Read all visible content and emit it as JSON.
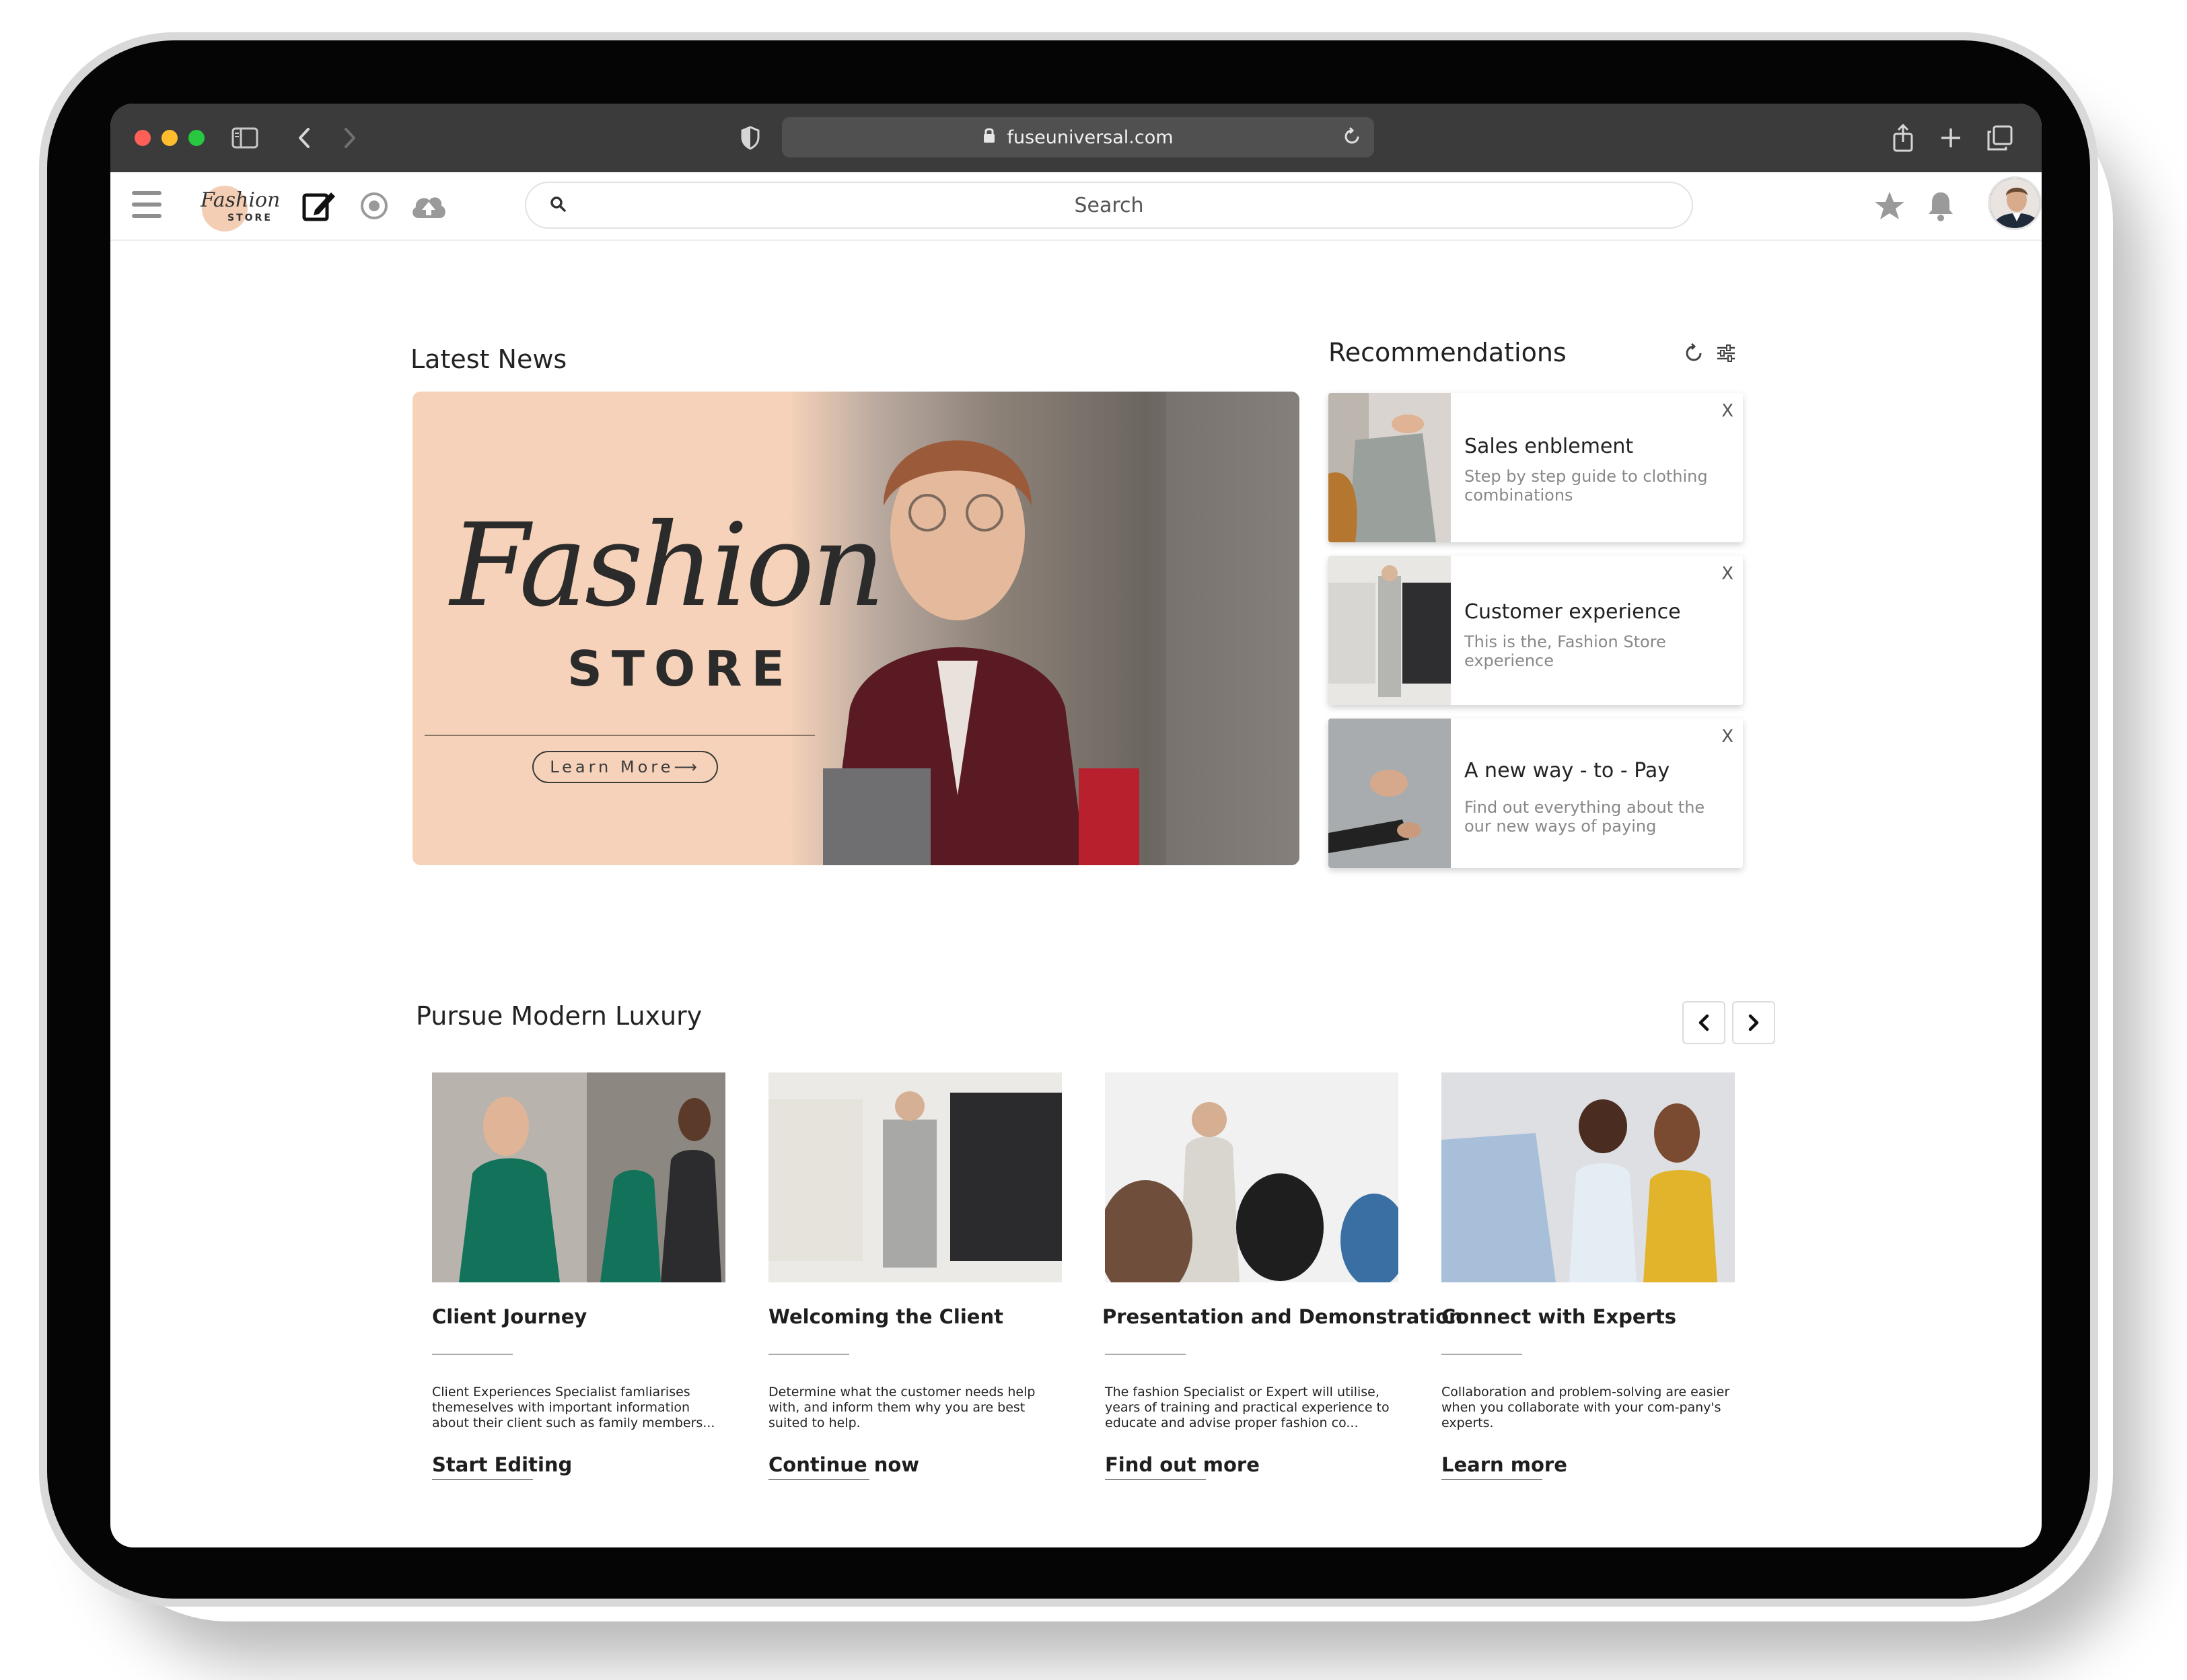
{
  "browser": {
    "url": "fuseuniversal.com"
  },
  "header": {
    "logo_text": "Fashion",
    "logo_subtext": "STORE",
    "search_placeholder": "Search"
  },
  "latest_news": {
    "title": "Latest News",
    "hero": {
      "script_text": "Fashion",
      "store_text": "STORE",
      "button_label": "Learn More⟶"
    }
  },
  "recommendations": {
    "title": "Recommendations",
    "items": [
      {
        "title": "Sales enblement",
        "description": "Step by step guide to clothing combinations",
        "close": "X"
      },
      {
        "title": "Customer experience",
        "description": "This is the, Fashion Store experience",
        "close": "X"
      },
      {
        "title": "A new way - to - Pay",
        "description": "Find out everything about the our new ways of paying",
        "close": "X"
      }
    ]
  },
  "luxury": {
    "title": "Pursue Modern Luxury",
    "cards": [
      {
        "title": "Client Journey",
        "description": "Client Experiences Specialist famliarises themeselves with important information about their client such as family members...",
        "link": "Start Editing"
      },
      {
        "title": "Welcoming the Client",
        "description": "Determine what the customer needs help with, and inform them why you are best suited to help.",
        "link": "Continue now"
      },
      {
        "title": "Presentation and Demonstration",
        "description": "The fashion Specialist or Expert will utilise, years of training and practical experience to educate and advise proper fashion co...",
        "link": "Find out more"
      },
      {
        "title": "Connect with Experts",
        "description": "Collaboration and problem-solving are easier when you collaborate with your com-pany's experts.",
        "link": "Learn more"
      }
    ]
  },
  "colors": {
    "hero_peach": "#f5d2b9",
    "browser_chrome": "#3b3b3b",
    "text_dark": "#222222"
  }
}
